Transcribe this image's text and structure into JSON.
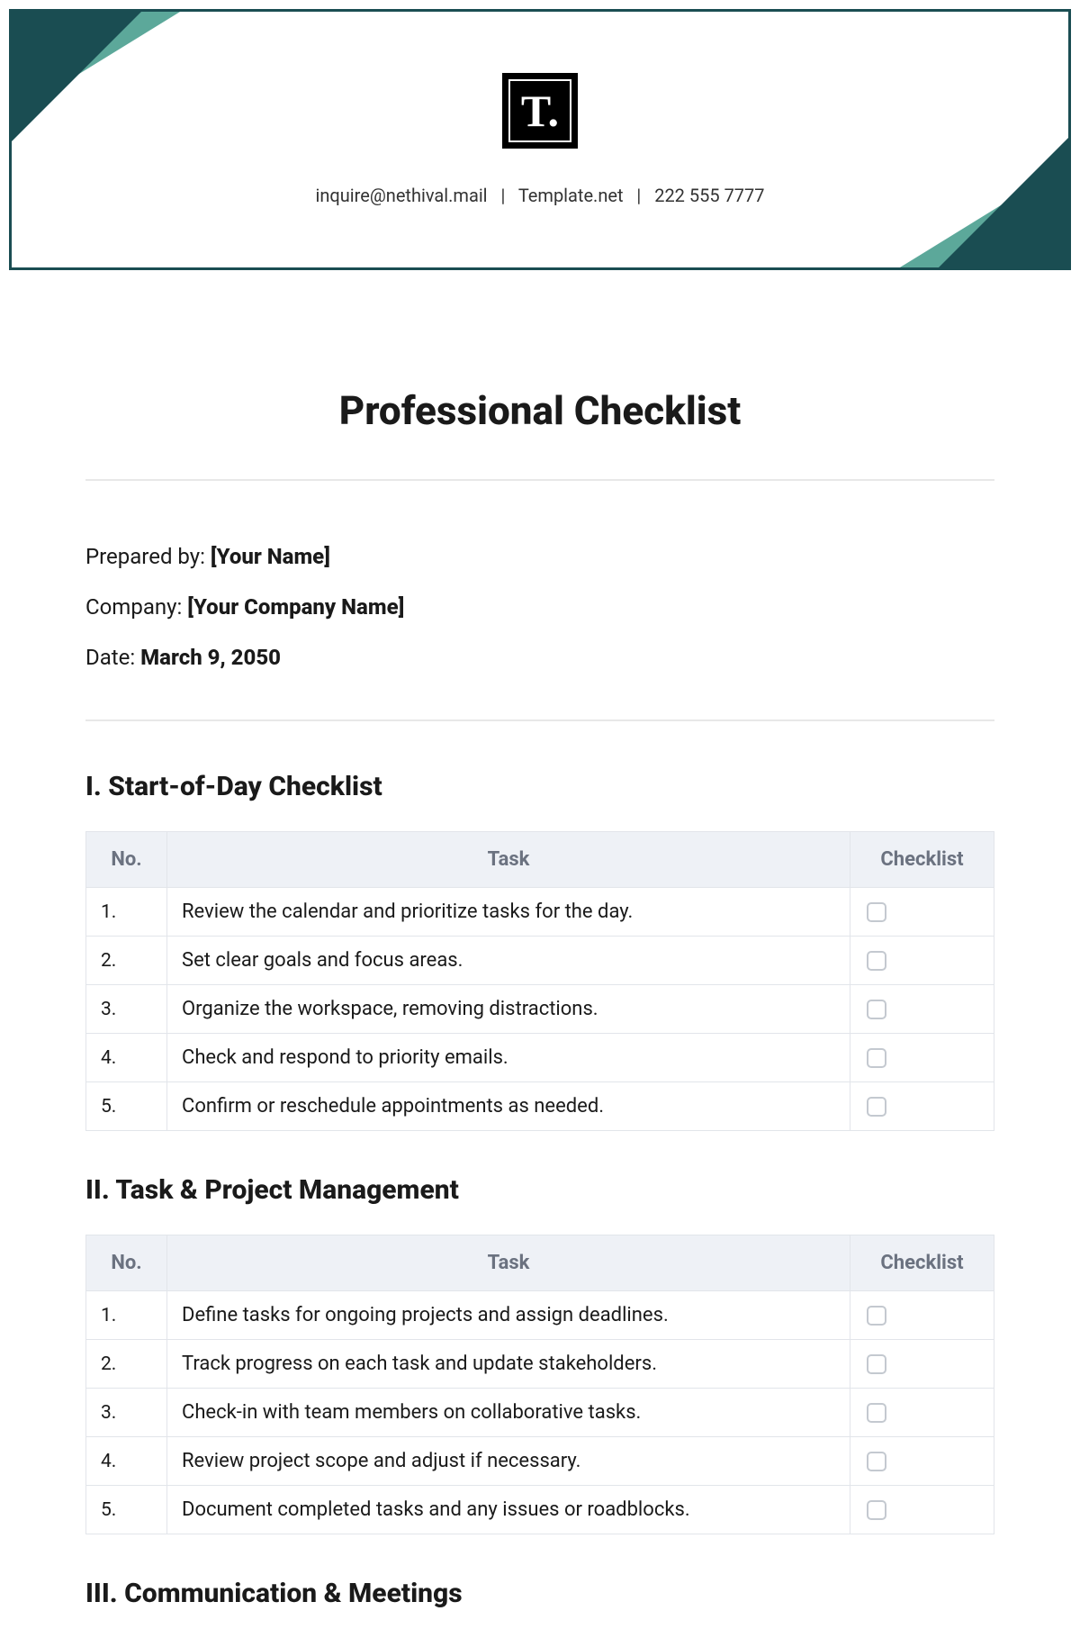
{
  "header": {
    "logo_text": "T.",
    "email": "inquire@nethival.mail",
    "website": "Template.net",
    "phone": "222 555 7777"
  },
  "title": "Professional Checklist",
  "meta": {
    "prepared_by_label": "Prepared by: ",
    "prepared_by_value": "[Your Name]",
    "company_label": "Company: ",
    "company_value": "[Your Company Name]",
    "date_label": "Date: ",
    "date_value": "March 9, 2050"
  },
  "columns": {
    "no": "No.",
    "task": "Task",
    "checklist": "Checklist"
  },
  "sections": [
    {
      "heading": "I. Start-of-Day Checklist",
      "rows": [
        {
          "no": "1.",
          "task": "Review the calendar and prioritize tasks for the day."
        },
        {
          "no": "2.",
          "task": "Set clear goals and focus areas."
        },
        {
          "no": "3.",
          "task": "Organize the workspace, removing distractions."
        },
        {
          "no": "4.",
          "task": "Check and respond to priority emails."
        },
        {
          "no": "5.",
          "task": "Confirm or reschedule appointments as needed."
        }
      ]
    },
    {
      "heading": "II. Task & Project Management",
      "rows": [
        {
          "no": "1.",
          "task": "Define tasks for ongoing projects and assign deadlines."
        },
        {
          "no": "2.",
          "task": "Track progress on each task and update stakeholders."
        },
        {
          "no": "3.",
          "task": "Check-in with team members on collaborative tasks."
        },
        {
          "no": "4.",
          "task": "Review project scope and adjust if necessary."
        },
        {
          "no": "5.",
          "task": "Document completed tasks and any issues or roadblocks."
        }
      ]
    },
    {
      "heading": "III. Communication & Meetings",
      "rows": []
    }
  ]
}
